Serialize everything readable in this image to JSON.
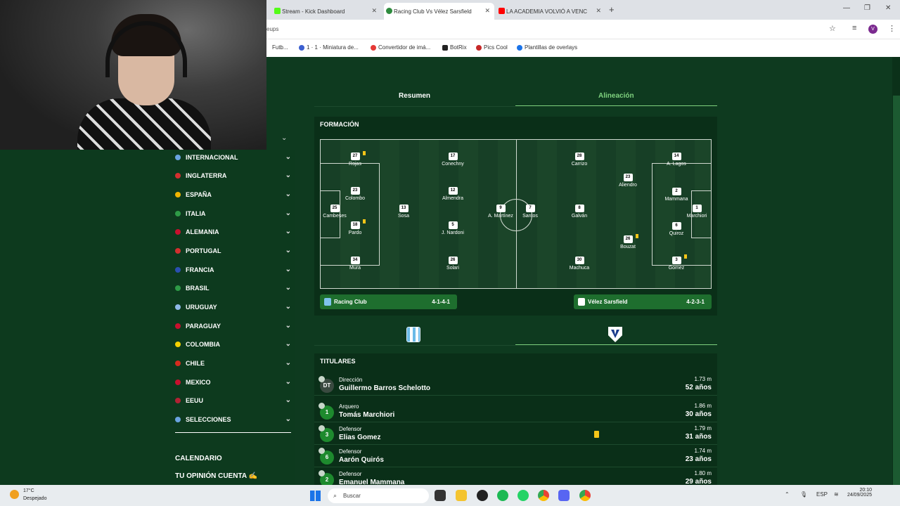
{
  "browser": {
    "tabs": [
      {
        "label": "Stream - Kick Dashboard",
        "icon": "kick-icon"
      },
      {
        "label": "Racing Club Vs Vélez Sarsfield",
        "icon": "soccer-site-icon"
      },
      {
        "label": "LA ACADEMIA VOLVIÓ A VENC",
        "icon": "youtube-icon"
      }
    ],
    "url_fragment": "eups",
    "profile_initial": "V",
    "bookmarks": [
      "Futb...",
      "1 · 1 · Miniatura de...",
      "Convertidor de imá...",
      "BotRix",
      "Pics Cool",
      "Plantillas de overlays"
    ]
  },
  "sidebar": {
    "countries": [
      "INTERNACIONAL",
      "INGLATERRA",
      "ESPAÑA",
      "ITALIA",
      "ALEMANIA",
      "PORTUGAL",
      "FRANCIA",
      "BRASIL",
      "URUGUAY",
      "PARAGUAY",
      "COLOMBIA",
      "CHILE",
      "MEXICO",
      "EEUU",
      "SELECCIONES"
    ],
    "links": [
      "CALENDARIO",
      "TU OPINIÓN CUENTA ✍"
    ]
  },
  "main": {
    "tabs": {
      "resumen": "Resumen",
      "alineacion": "Alineación"
    },
    "formacion_title": "FORMACIÓN",
    "home": {
      "name": "Racing Club",
      "formation": "4-1-4-1"
    },
    "away": {
      "name": "Vélez Sarsfield",
      "formation": "4-2-3-1"
    },
    "home_players": [
      {
        "num": "27",
        "name": "Rojas"
      },
      {
        "num": "23",
        "name": "Colombo"
      },
      {
        "num": "25",
        "name": "Cambeses"
      },
      {
        "num": "18",
        "name": "Pardo"
      },
      {
        "num": "34",
        "name": "Mura"
      },
      {
        "num": "13",
        "name": "Sosa"
      },
      {
        "num": "17",
        "name": "Conechny"
      },
      {
        "num": "12",
        "name": "Almendra"
      },
      {
        "num": "5",
        "name": "J. Nardoni"
      },
      {
        "num": "26",
        "name": "Solari"
      },
      {
        "num": "9",
        "name": "A. Martínez"
      }
    ],
    "away_players": [
      {
        "num": "7",
        "name": "Santos"
      },
      {
        "num": "28",
        "name": "Carrizo"
      },
      {
        "num": "8",
        "name": "Galván"
      },
      {
        "num": "30",
        "name": "Machuca"
      },
      {
        "num": "23",
        "name": "Aliendro"
      },
      {
        "num": "26",
        "name": "Bouzat"
      },
      {
        "num": "14",
        "name": "A. Lagos"
      },
      {
        "num": "2",
        "name": "Mammana"
      },
      {
        "num": "6",
        "name": "Quiroz"
      },
      {
        "num": "3",
        "name": "Gomez"
      },
      {
        "num": "1",
        "name": "Marchiori"
      }
    ],
    "titulares_title": "TITULARES",
    "titulares": [
      {
        "num": "DT",
        "role": "Dirección",
        "name": "Guillermo Barros Schelotto",
        "height": "1.73 m",
        "age": "52 años"
      },
      {
        "num": "1",
        "role": "Arquero",
        "name": "Tomás Marchiori",
        "height": "1.86 m",
        "age": "30 años"
      },
      {
        "num": "3",
        "role": "Defensor",
        "name": "Elias Gomez",
        "height": "1.79 m",
        "age": "31 años"
      },
      {
        "num": "6",
        "role": "Defensor",
        "name": "Aarón Quirós",
        "height": "1.74 m",
        "age": "23 años"
      },
      {
        "num": "2",
        "role": "Defensor",
        "name": "Emanuel Mammana",
        "height": "1.80 m",
        "age": "29 años"
      }
    ]
  },
  "taskbar": {
    "temp": "17°C",
    "weather": "Despejado",
    "search_placeholder": "Buscar",
    "lang": "ESP",
    "time": "20:10",
    "date": "24/09/2025"
  },
  "colors": {
    "accent_green": "#7fd27f",
    "team_bar": "#1e6e2e",
    "yellow_card": "#f5c518"
  }
}
